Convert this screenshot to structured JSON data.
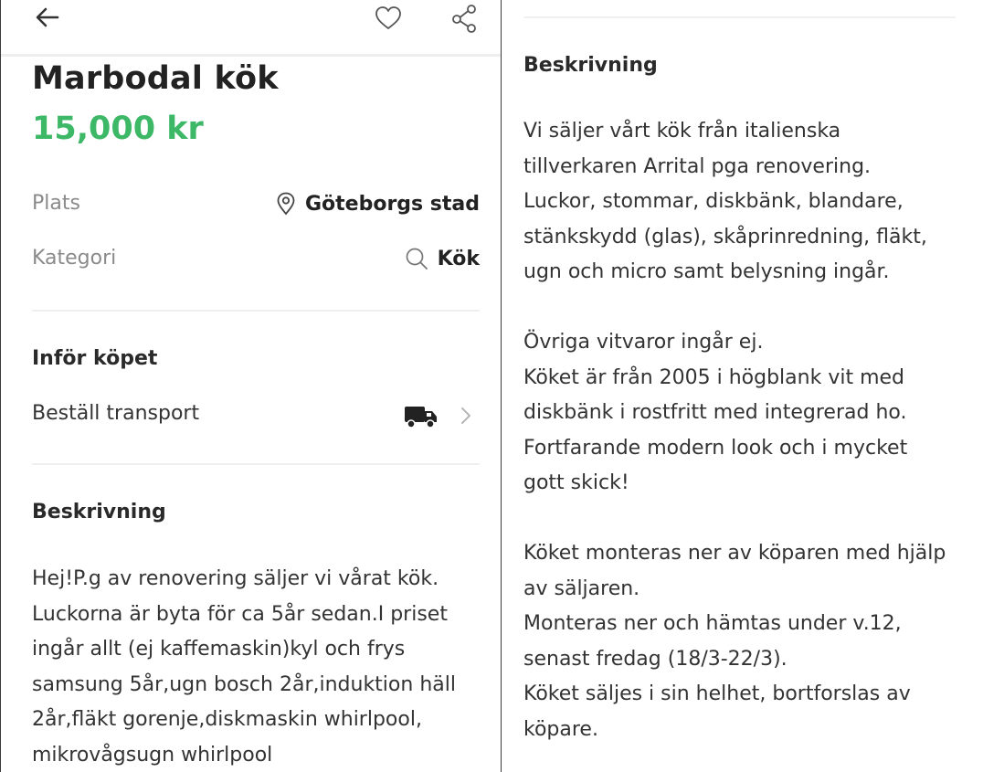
{
  "listing": {
    "title": "Marbodal kök",
    "price": "15,000 kr"
  },
  "details": {
    "location_label": "Plats",
    "location_value": "Göteborgs stad",
    "category_label": "Kategori",
    "category_value": "Kök"
  },
  "purchase": {
    "heading": "Inför köpet",
    "transport_label": "Beställ transport"
  },
  "description_left": {
    "heading": "Beskrivning",
    "lines": [
      "Hej!P.g av renovering säljer vi vårat kök.",
      "Luckorna är byta för ca 5år sedan.I priset",
      "ingår allt (ej kaffemaskin)kyl och frys",
      "samsung 5år,ugn bosch 2år,induktion häll",
      "2år,fläkt gorenje,diskmaskin whirlpool,",
      "mikrovågsugn whirlpool"
    ]
  },
  "description_right": {
    "heading": "Beskrivning",
    "lines": [
      "Vi säljer vårt kök från italienska",
      "tillverkaren Arrital pga renovering.",
      "Luckor, stommar, diskbänk, blandare,",
      "stänkskydd (glas), skåprinredning, fläkt,",
      "ugn och micro samt belysning ingår.",
      "",
      "Övriga vitvaror ingår ej.",
      "Köket är från 2005 i högblank vit med",
      "diskbänk i rostfritt med integrerad ho.",
      "Fortfarande modern look och i mycket",
      "gott skick!",
      "",
      "Köket monteras ner av köparen med hjälp",
      "av säljaren.",
      "Monteras ner och hämtas under v.12,",
      "senast fredag (18/3-22/3).",
      "Köket säljes i sin helhet, bortforslas av",
      "köpare."
    ]
  },
  "icons": {
    "back": "arrow-left-icon",
    "favorite": "heart-icon",
    "share": "share-icon",
    "location": "location-pin-icon",
    "category": "search-icon",
    "transport": "truck-icon",
    "chevron": "chevron-right-icon"
  },
  "colors": {
    "price": "#3cb867",
    "text": "#2a2a2a",
    "muted": "#8a8a8a",
    "divider": "#efefef"
  }
}
